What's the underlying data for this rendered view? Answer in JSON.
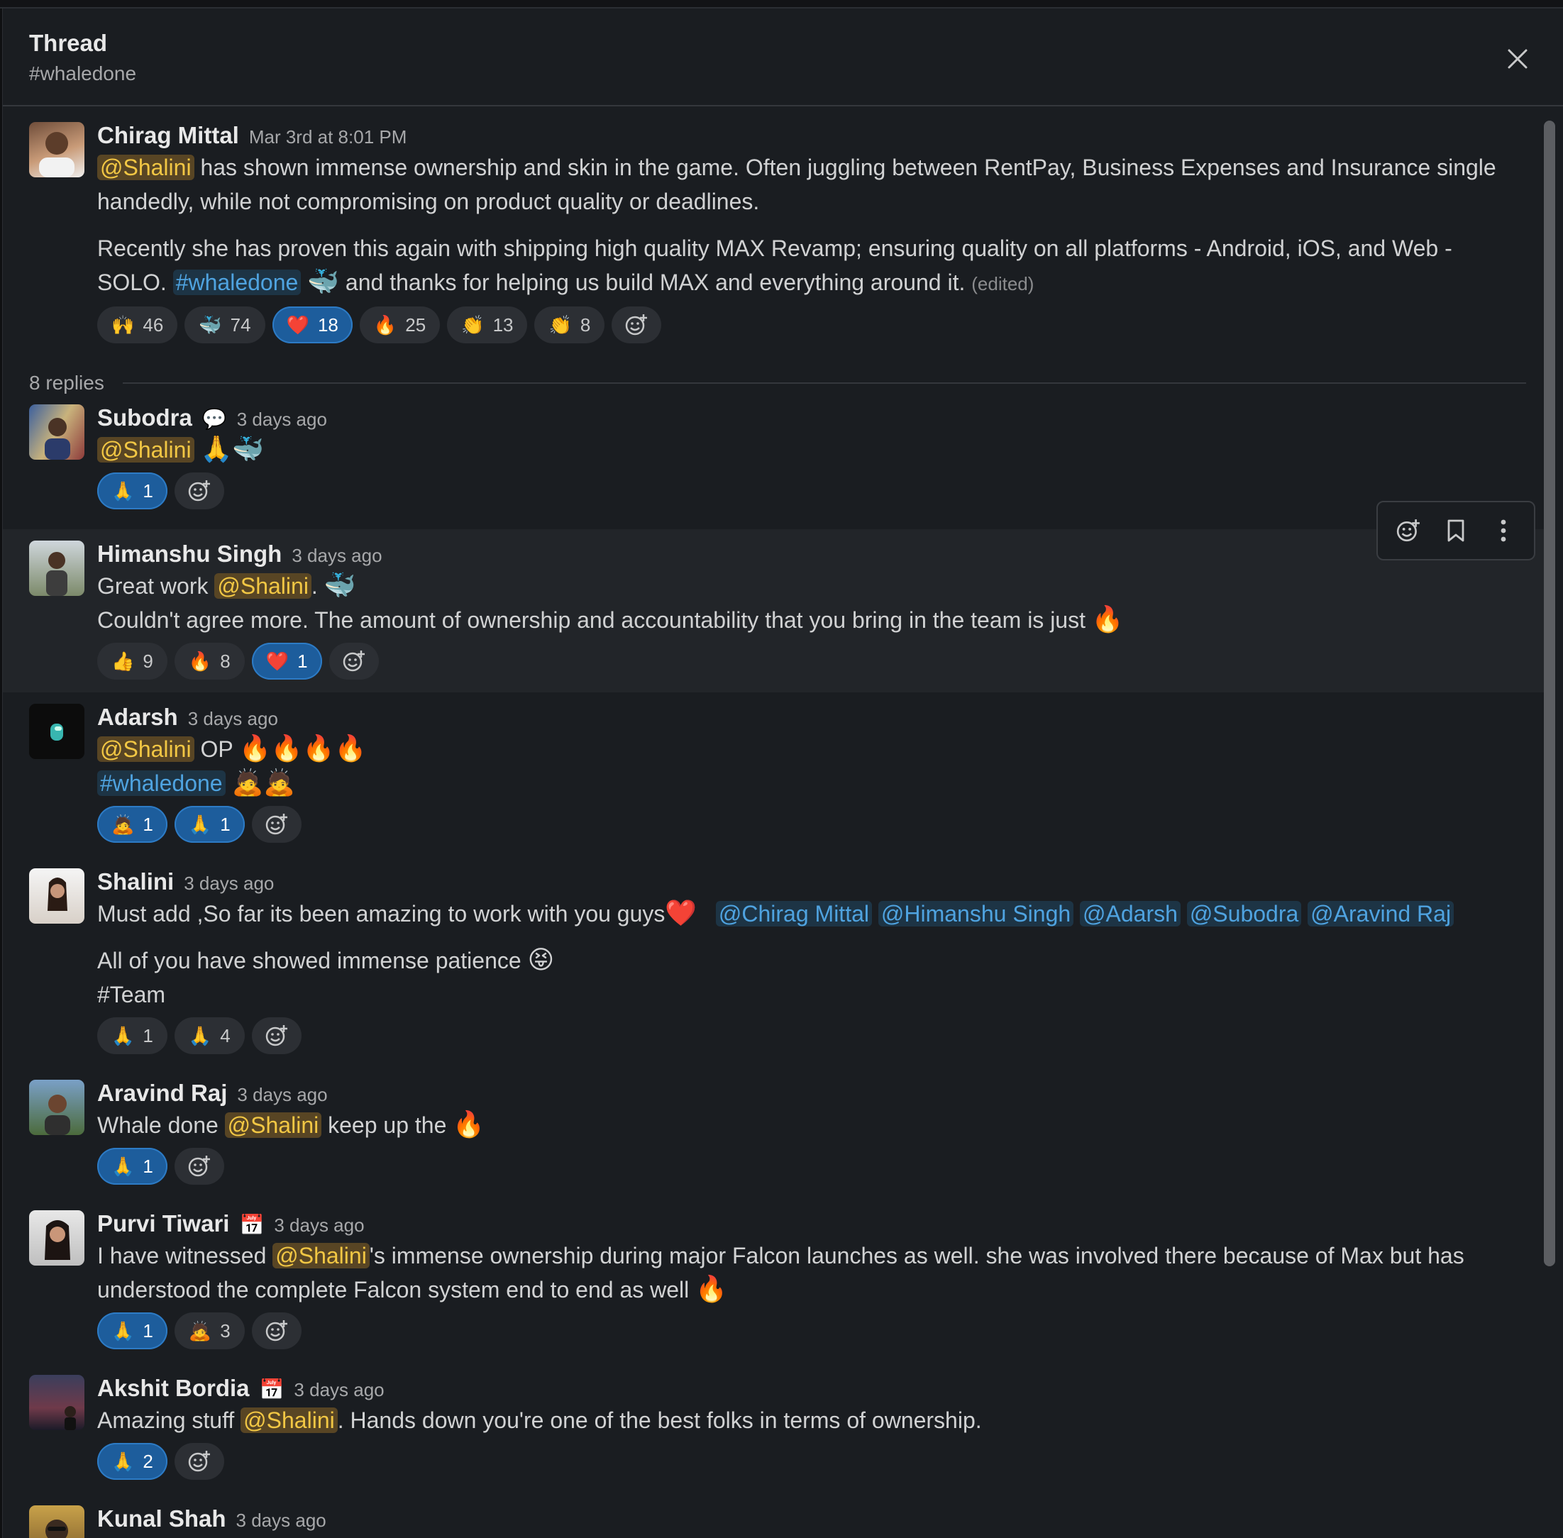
{
  "header": {
    "title": "Thread",
    "channel": "#whaledone"
  },
  "parent": {
    "author": "Chirag Mittal",
    "time": "Mar 3rd at 8:01 PM",
    "mention": "@Shalini",
    "p1_rest": " has shown immense ownership and skin in the game. Often juggling between RentPay, Business Expenses and Insurance single handedly, while not compromising on product quality or deadlines.",
    "p2_start": "Recently she has proven this again with shipping high quality MAX Revamp; ensuring quality on all platforms - Android, iOS, and Web - SOLO. ",
    "p2_channel": "#whaledone",
    "p2_emoji": "🐳",
    "p2_end": " and thanks for helping us build MAX and everything around it. ",
    "edited": "(edited)",
    "reactions": [
      {
        "emoji": "🙌",
        "count": "46"
      },
      {
        "emoji": "🐳",
        "count": "74"
      },
      {
        "emoji": "❤️",
        "count": "18",
        "active": true
      },
      {
        "emoji": "🔥",
        "count": "25"
      },
      {
        "emoji": "👏",
        "count": "13"
      },
      {
        "emoji": "👏",
        "count": "8"
      }
    ]
  },
  "replies_label": "8 replies",
  "replies": [
    {
      "author": "Subodra",
      "status": "💬",
      "time": "3 days ago",
      "mention": "@Shalini",
      "emojis": "🙏🐳",
      "reactions": [
        {
          "emoji": "🙏",
          "count": "1",
          "active": true
        }
      ]
    },
    {
      "author": "Himanshu Singh",
      "time": "3 days ago",
      "pre": "Great work ",
      "mention": "@Shalini",
      "post": ". ",
      "emoji": "🐳",
      "line2": "Couldn't agree more. The amount of ownership and accountability that you bring in the team is just ",
      "line2_emoji": "🔥",
      "reactions": [
        {
          "emoji": "👍",
          "count": "9"
        },
        {
          "emoji": "🔥",
          "count": "8"
        },
        {
          "emoji": "❤️",
          "count": "1",
          "active": true
        }
      ]
    },
    {
      "author": "Adarsh",
      "time": "3 days ago",
      "mention": "@Shalini",
      "op": " OP ",
      "fires": "🔥🔥🔥🔥",
      "channel": "#whaledone",
      "bows": "🙇🙇",
      "reactions": [
        {
          "emoji": "🙇",
          "count": "1",
          "active": true
        },
        {
          "emoji": "🙏",
          "count": "1",
          "active": true
        }
      ]
    },
    {
      "author": "Shalini",
      "time": "3 days ago",
      "line1": "Must add ,So far its been amazing to work with you guys",
      "heart": "❤️",
      "mentions": [
        "@Chirag Mittal",
        "@Himanshu Singh",
        "@Adarsh",
        "@Subodra",
        "@Aravind Raj"
      ],
      "line2": "All of you have showed immense patience ",
      "line2_emoji": "😝",
      "line3": "#Team",
      "reactions": [
        {
          "emoji": "🙏",
          "count": "1"
        },
        {
          "emoji": "🙏",
          "count": "4"
        }
      ]
    },
    {
      "author": "Aravind Raj",
      "time": "3 days ago",
      "pre": "Whale done ",
      "mention": "@Shalini",
      "post": " keep up the ",
      "emoji": "🔥",
      "reactions": [
        {
          "emoji": "🙏",
          "count": "1",
          "active": true
        }
      ]
    },
    {
      "author": "Purvi Tiwari",
      "status": "📅",
      "time": "3 days ago",
      "pre": "I have witnessed ",
      "mention": "@Shalini",
      "post": "'s immense ownership during major Falcon launches as well. she was involved there because of Max but has understood the complete Falcon system end to end as well ",
      "emoji": "🔥",
      "reactions": [
        {
          "emoji": "🙏",
          "count": "1",
          "active": true
        },
        {
          "emoji": "🙇",
          "count": "3"
        }
      ]
    },
    {
      "author": "Akshit Bordia",
      "status": "📅",
      "time": "3 days ago",
      "pre": "Amazing stuff ",
      "mention": "@Shalini",
      "post": ". Hands down you're one of the best folks in terms of ownership.",
      "reactions": [
        {
          "emoji": "🙏",
          "count": "2",
          "active": true
        }
      ]
    },
    {
      "author": "Kunal Shah",
      "time": "3 days ago"
    }
  ],
  "icons": {
    "close": "close-icon",
    "add_reaction": "add-reaction-icon",
    "bookmark": "bookmark-icon",
    "more": "more-vertical-icon"
  },
  "colors": {
    "background": "#1a1d21",
    "mention_bg": "#584524",
    "mention_fg": "#f2c744",
    "link": "#4fa3e0",
    "active_reaction": "#1d5d9c"
  }
}
